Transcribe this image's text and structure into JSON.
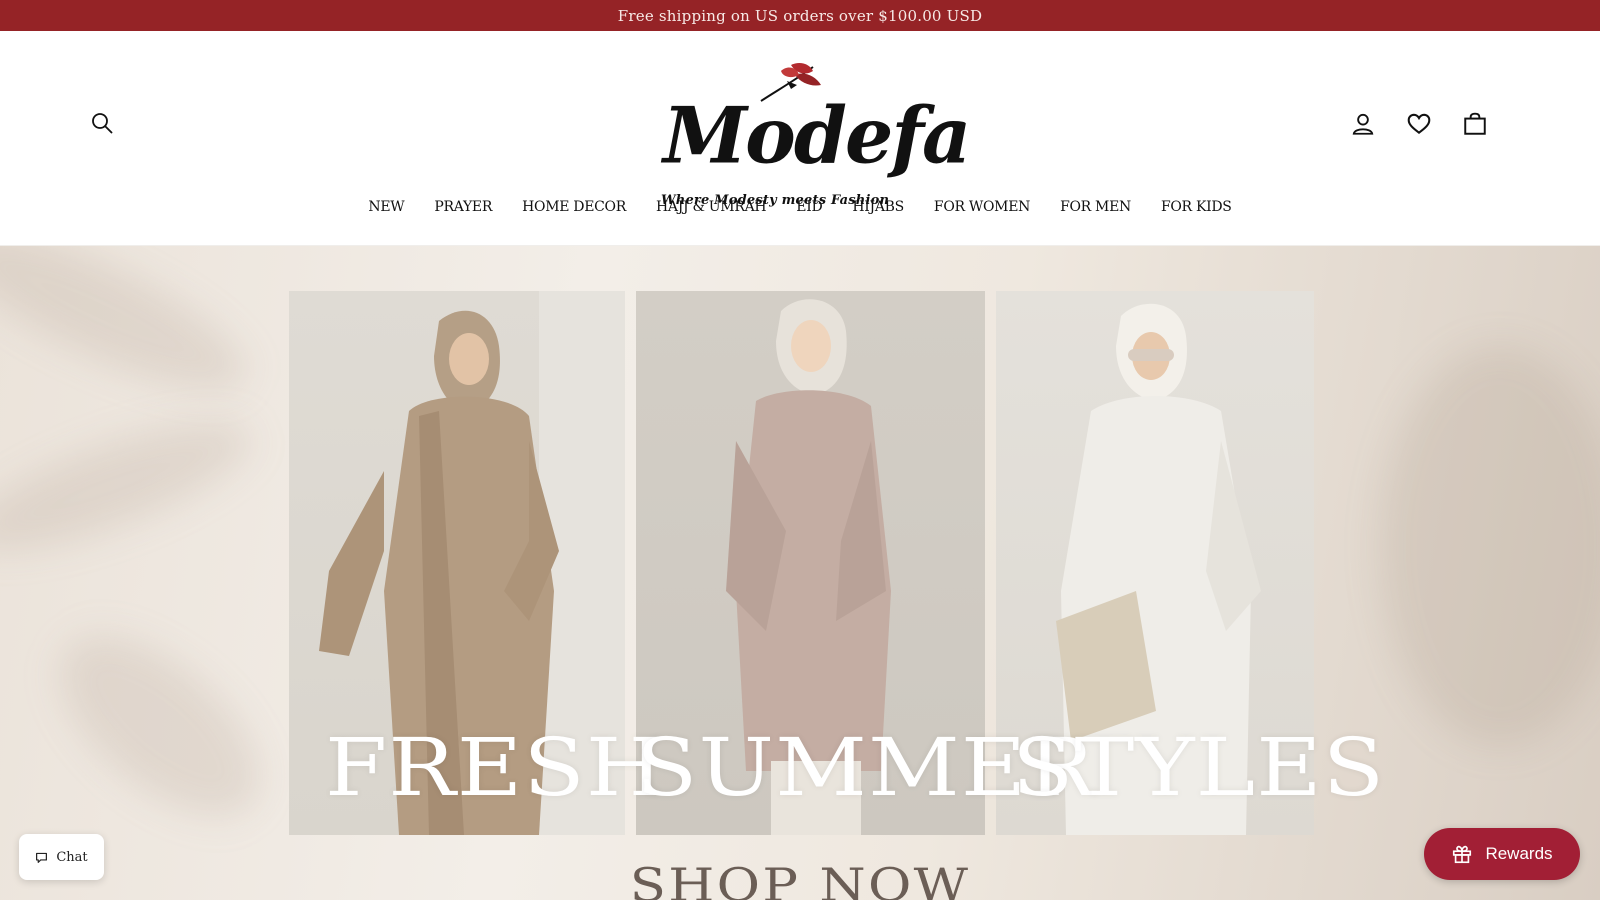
{
  "announcement": {
    "text": "Free shipping on US orders over $100.00 USD"
  },
  "brand": {
    "logo_text": "Modefa",
    "tagline": "Where Modesty meets Fashion",
    "accent_color": "#952326"
  },
  "header": {
    "icons": [
      "search-icon",
      "account-icon",
      "heart-icon",
      "cart-icon"
    ]
  },
  "nav": {
    "items": [
      {
        "label": "NEW"
      },
      {
        "label": "PRAYER"
      },
      {
        "label": "HOME DECOR"
      },
      {
        "label": "HAJJ & UMRAH"
      },
      {
        "label": "EID"
      },
      {
        "label": "HIJABS"
      },
      {
        "label": "FOR WOMEN"
      },
      {
        "label": "FOR MEN"
      },
      {
        "label": "FOR KIDS"
      }
    ]
  },
  "hero": {
    "words": [
      "FRESH",
      "SUMMER",
      "STYLES"
    ],
    "cta": "SHOP NOW"
  },
  "widgets": {
    "chat_label": "Chat",
    "rewards_label": "Rewards",
    "rewards_color": "#a21f35"
  }
}
